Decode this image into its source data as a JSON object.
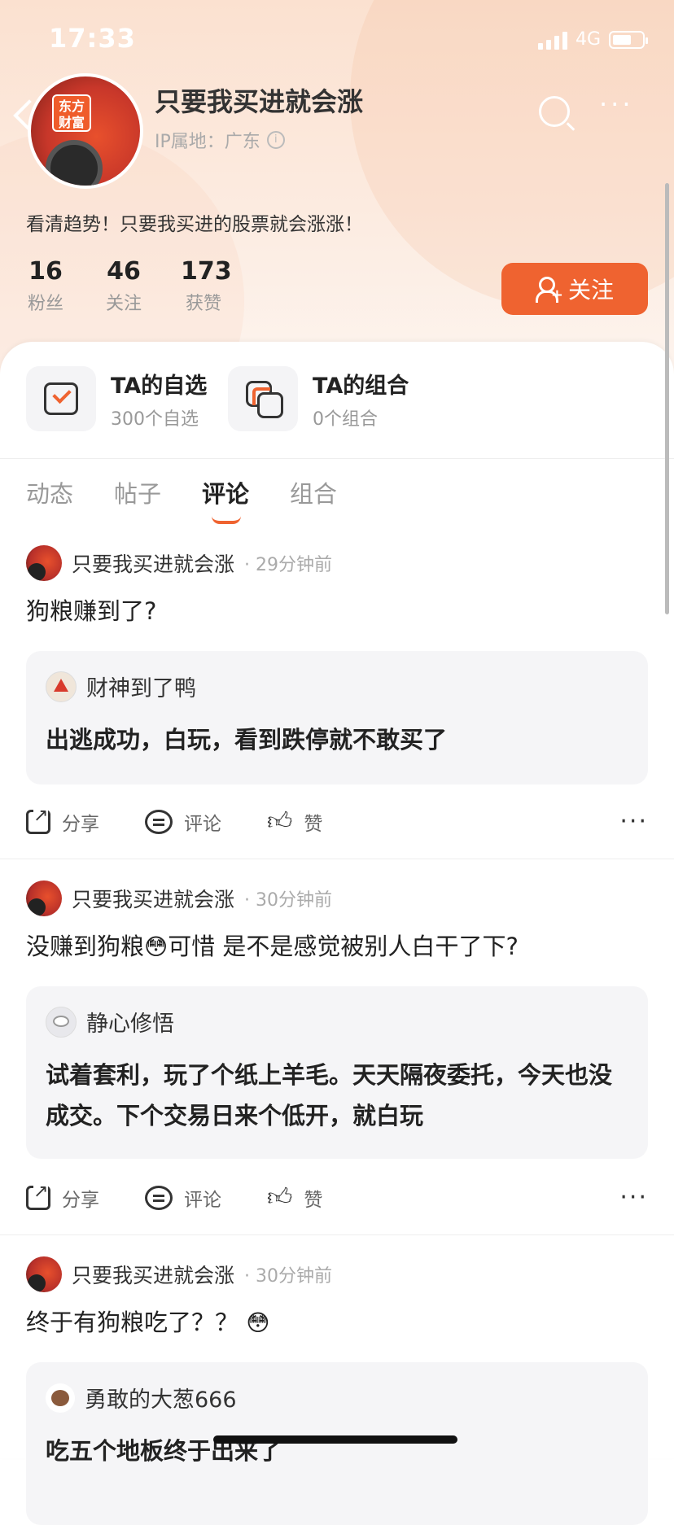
{
  "status_bar": {
    "time": "17:33",
    "network": "4G",
    "battery_level": 0.65
  },
  "profile": {
    "name": "只要我买进就会涨",
    "ip_location": "IP属地：广东",
    "avatar_logo_text": "东方财富",
    "bio": "看清趋势！只要我买进的股票就会涨涨！",
    "stats": [
      {
        "value": "16",
        "label": "粉丝"
      },
      {
        "value": "46",
        "label": "关注"
      },
      {
        "value": "173",
        "label": "获赞"
      }
    ],
    "follow_label": "关注"
  },
  "features": [
    {
      "title": "TA的自选",
      "subtitle": "300个自选",
      "icon": "watchlist-icon"
    },
    {
      "title": "TA的组合",
      "subtitle": "0个组合",
      "icon": "portfolio-icon"
    }
  ],
  "tabs": [
    {
      "label": "动态",
      "active": false
    },
    {
      "label": "帖子",
      "active": false
    },
    {
      "label": "评论",
      "active": true
    },
    {
      "label": "组合",
      "active": false
    }
  ],
  "actions": {
    "share": "分享",
    "comment": "评论",
    "like": "赞"
  },
  "posts": [
    {
      "author": "只要我买进就会涨",
      "time": "· 29分钟前",
      "text": "狗粮赚到了?",
      "quote": {
        "author": "财神到了鸭",
        "text": "出逃成功，白玩，看到跌停就不敢买了"
      }
    },
    {
      "author": "只要我买进就会涨",
      "time": "· 30分钟前",
      "text_before": "没赚到狗粮",
      "emoji": "😳",
      "text_after": "可惜 是不是感觉被别人白干了下?",
      "quote": {
        "author": "静心修悟",
        "text": "试着套利，玩了个纸上羊毛。天天隔夜委托，今天也没成交。下个交易日来个低开，就白玩"
      }
    },
    {
      "author": "只要我买进就会涨",
      "time": "· 30分钟前",
      "text": "终于有狗粮吃了？？",
      "emoji": "😳",
      "quote": {
        "author": "勇敢的大葱666",
        "text": "吃五个地板终于出来了"
      }
    }
  ]
}
